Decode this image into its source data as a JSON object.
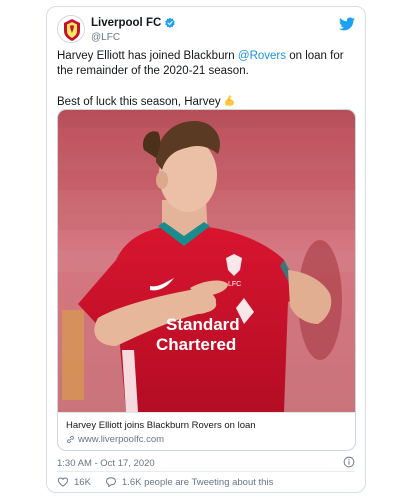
{
  "account": {
    "display_name": "Liverpool FC",
    "handle": "@LFC",
    "verified_icon": "verified-badge-icon",
    "logo_icon": "twitter-bird-icon"
  },
  "tweet": {
    "line1_pre": "Harvey Elliott has joined Blackburn ",
    "mention": "@Rovers",
    "line1_post": " on loan for the remainder of the 2020-21 season.",
    "line2": "Best of luck this season, Harvey",
    "emoji": "flexed-biceps-emoji"
  },
  "link_card": {
    "title": "Harvey Elliott joins Blackburn Rovers on loan",
    "url": "www.liverpoolfc.com",
    "photo_shirt_text_1": "Standard",
    "photo_shirt_text_2": "Chartered"
  },
  "meta": {
    "timestamp": "1:30 AM - Oct 17, 2020"
  },
  "actions": {
    "likes": "16K",
    "tweeting": "1.6K people are Tweeting about this"
  },
  "colors": {
    "accent": "#1b95e0",
    "muted": "#657786",
    "kit_red": "#c8102e"
  }
}
